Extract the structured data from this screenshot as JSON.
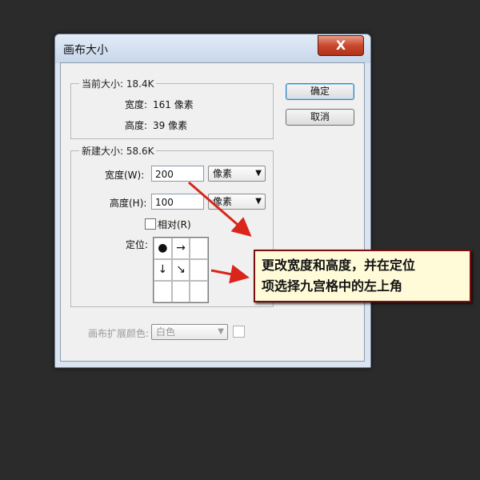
{
  "dialog": {
    "title": "画布大小",
    "close_label": "X",
    "current_size": {
      "legend": "当前大小: 18.4K",
      "width_label": "宽度:",
      "width_value": "161 像素",
      "height_label": "高度:",
      "height_value": "39 像素"
    },
    "new_size": {
      "legend": "新建大小: 58.6K",
      "width_label": "宽度(W):",
      "width_value": "200",
      "width_unit": "像素",
      "height_label": "高度(H):",
      "height_value": "100",
      "height_unit": "像素",
      "relative_label": "相对(R)",
      "anchor_label": "定位:",
      "anchor_cells": [
        "●",
        "→",
        "",
        "↓",
        "↘",
        "",
        "",
        "",
        ""
      ]
    },
    "buttons": {
      "ok": "确定",
      "cancel": "取消"
    },
    "extension_color": {
      "label": "画布扩展颜色:",
      "value": "白色"
    }
  },
  "annotation": {
    "line1": "更改宽度和高度，并在定位",
    "line2": "项选择九宫格中的左上角",
    "arrow_color": "#d9251b"
  }
}
